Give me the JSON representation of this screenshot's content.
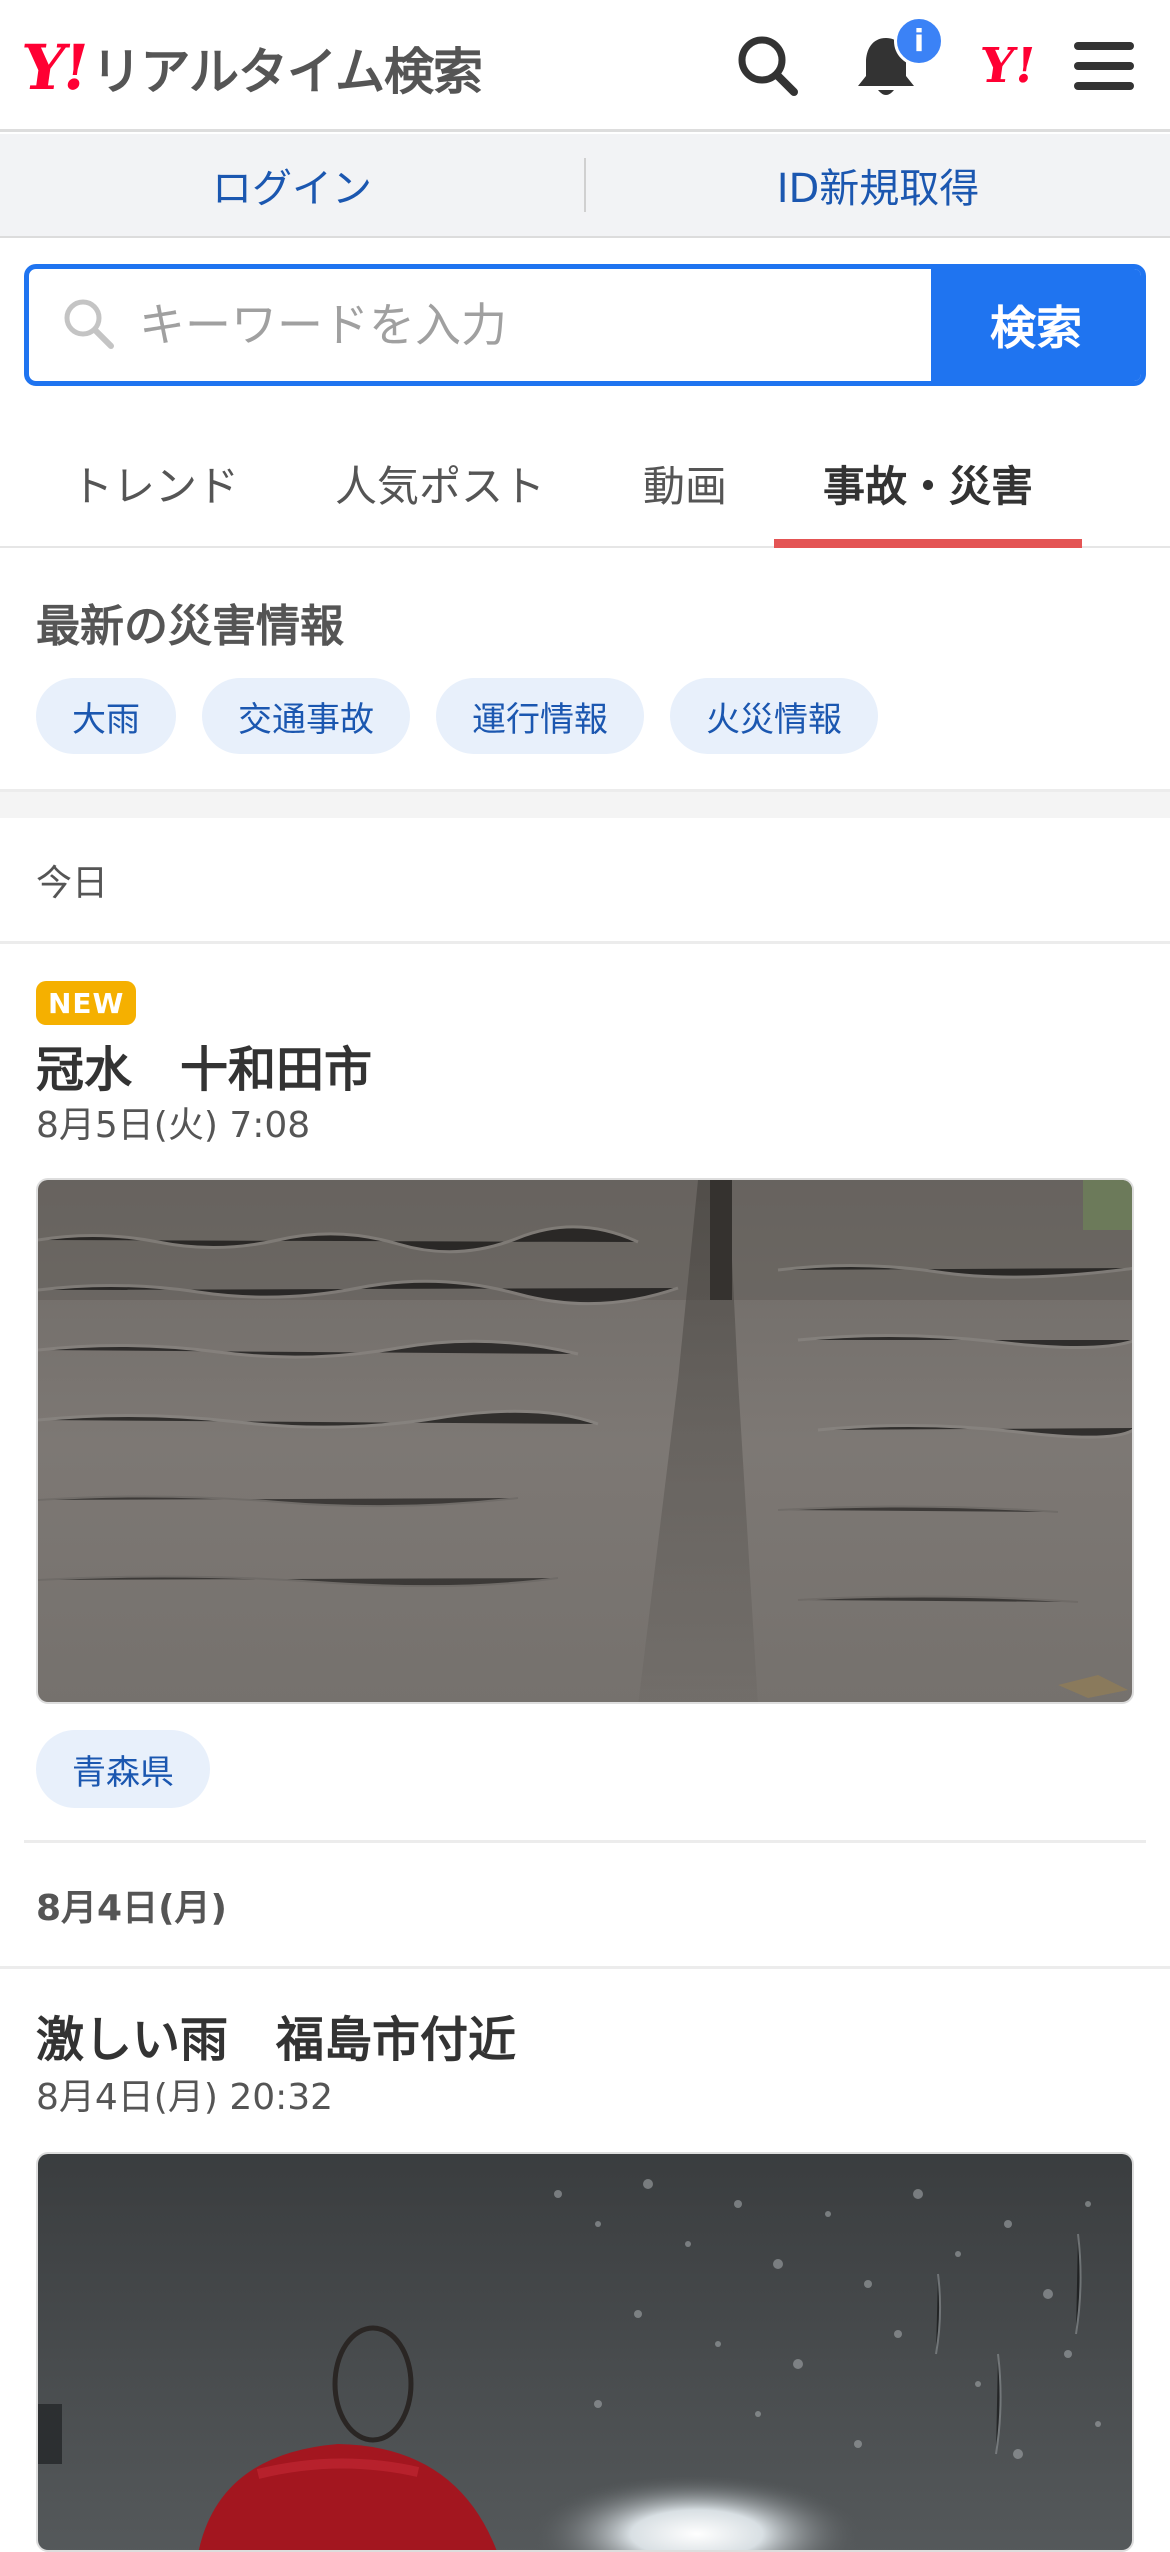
{
  "header": {
    "logo_mark": "Y!",
    "logo_text": "リアルタイム検索",
    "notification_badge": "i",
    "yahoo_mark": "Y!"
  },
  "login_bar": {
    "login": "ログイン",
    "register": "ID新規取得"
  },
  "search": {
    "placeholder": "キーワードを入力",
    "button": "検索"
  },
  "tabs": [
    {
      "label": "トレンド",
      "active": false
    },
    {
      "label": "人気ポスト",
      "active": false
    },
    {
      "label": "動画",
      "active": false
    },
    {
      "label": "事故・災害",
      "active": true
    }
  ],
  "disaster": {
    "heading": "最新の災害情報",
    "chips": [
      "大雨",
      "交通事故",
      "運行情報",
      "火災情報"
    ]
  },
  "sections": [
    {
      "date": "今日",
      "posts": [
        {
          "badge": "NEW",
          "title": "冠水　十和田市",
          "time": "8月5日(火) 7:08",
          "tag": "青森県"
        }
      ]
    },
    {
      "date": "8月4日(月)",
      "posts": [
        {
          "title": "激しい雨　福島市付近",
          "time": "8月4日(月) 20:32"
        }
      ]
    }
  ],
  "colors": {
    "brand_red": "#ff0033",
    "accent_blue": "#1f74f0",
    "link_blue": "#1b57b0",
    "tab_indicator": "#e45454",
    "new_badge": "#f5b000"
  }
}
